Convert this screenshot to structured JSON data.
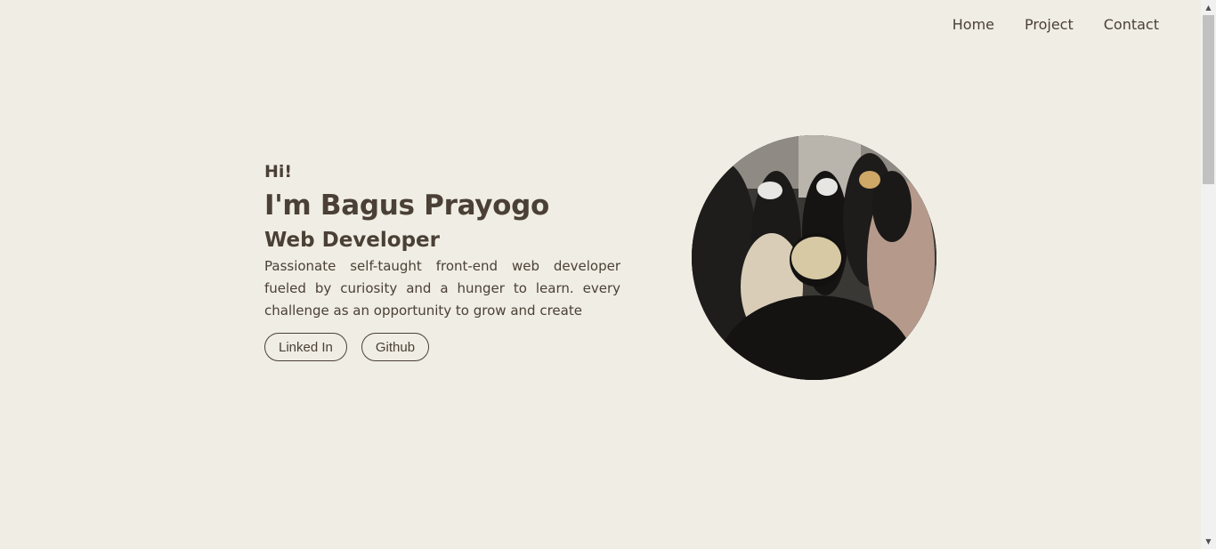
{
  "nav": {
    "items": [
      {
        "label": "Home"
      },
      {
        "label": "Project"
      },
      {
        "label": "Contact"
      }
    ]
  },
  "hero": {
    "greeting": "Hi!",
    "name": "I'm Bagus Prayogo",
    "role": "Web Developer",
    "description": "Passionate self-taught front-end web developer fueled by curiosity and a hunger to learn. every challenge as an opportunity to grow and create",
    "buttons": [
      {
        "label": "Linked In"
      },
      {
        "label": "Github"
      }
    ]
  },
  "scrollbar": {
    "up_icon": "▲",
    "down_icon": "▼"
  },
  "colors": {
    "background": "#f0ede4",
    "text": "#4a4036"
  }
}
